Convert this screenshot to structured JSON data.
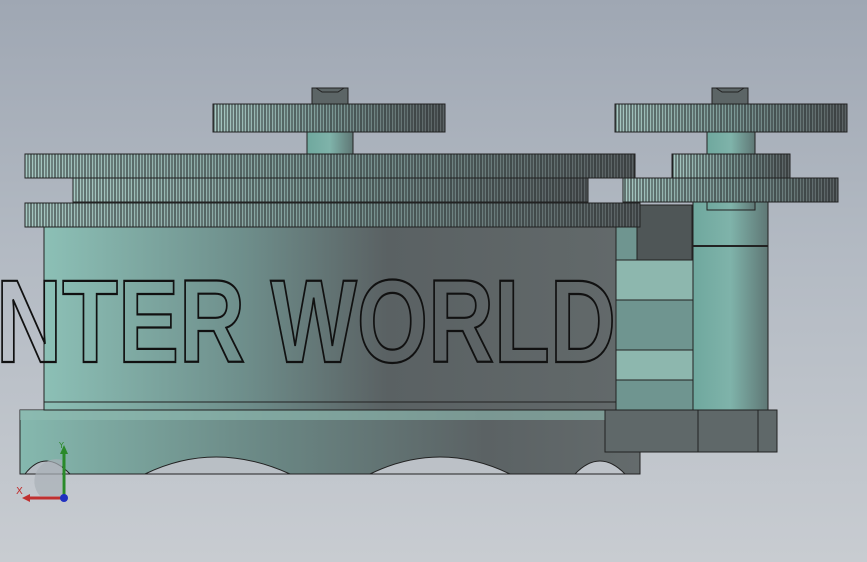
{
  "model": {
    "engraved_text": "NTER WORLD"
  },
  "triad": {
    "x_label": "X",
    "y_label": "Y",
    "x_color": "#c03030",
    "y_color": "#2a8a2a",
    "z_color": "#2030c0"
  },
  "colors": {
    "background_top": "#9fa7b3",
    "background_bottom": "#c8ccd1",
    "body_light": "#7fb3aa",
    "body_dark": "#5d6466",
    "gear_light": "#a9c9c3",
    "gear_dark": "#4d5556"
  }
}
